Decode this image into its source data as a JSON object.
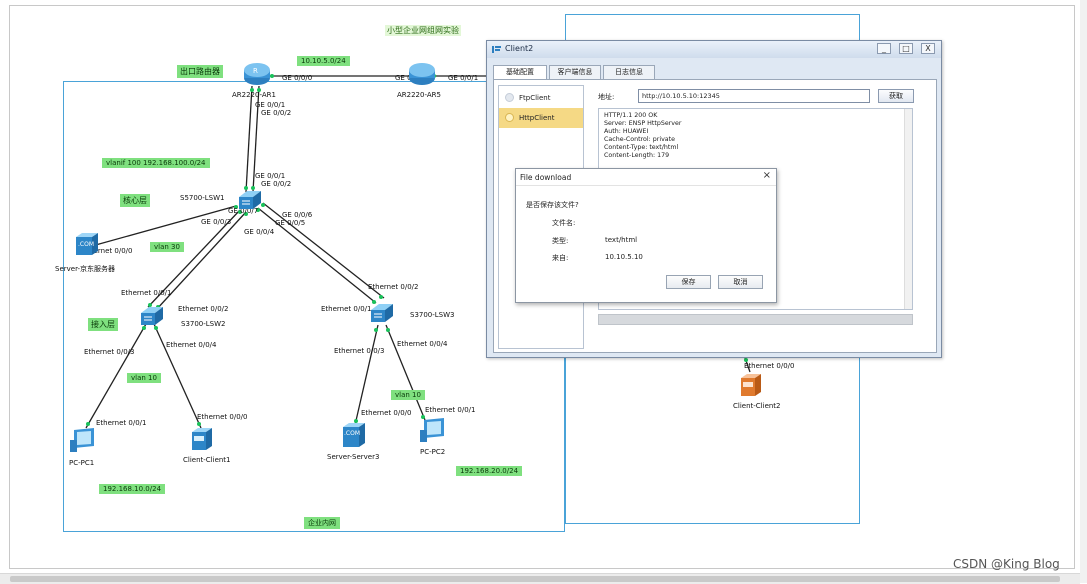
{
  "topology": {
    "title": "小型企业网组网实验",
    "areas": {
      "internal_label": "企业内网",
      "right_label": ""
    },
    "labels": {
      "exit_router": "出口路由器",
      "core_layer": "核心层",
      "access_layer": "接入层",
      "net_wan": "10.10.5.0/24",
      "vlanif": "vlanif 100 192.168.100.0/24",
      "vlan30": "vlan 30",
      "vlan10": "vlan 10",
      "vlan10b": "vlan 10",
      "net10": "192.168.10.0/24",
      "net20": "192.168.20.0/24"
    },
    "devices": {
      "ar1": "AR2220-AR1",
      "ar5": "AR2220-AR5",
      "lsw1": "S5700-LSW1",
      "lsw2": "S3700-LSW2",
      "lsw3": "S3700-LSW3",
      "server_jd": "Server-京东服务器",
      "pc1": "PC-PC1",
      "client1": "Client-Client1",
      "server3": "Server-Server3",
      "pc2": "PC-PC2",
      "client2": "Client-Client2"
    },
    "ports": {
      "ar1_ge000": "GE 0/0/0",
      "ar5_ge000": "GE 0/0/0",
      "ar5_ge001": "GE 0/0/1",
      "ar1_ge001": "GE 0/0/1",
      "ar1_ge002": "GE 0/0/2",
      "lsw1_ge001": "GE 0/0/1",
      "lsw1_ge002": "GE 0/0/2",
      "lsw1_ge007": "GE 0/0/7",
      "lsw1_ge003": "GE 0/0/3",
      "lsw1_ge004": "GE 0/0/4",
      "lsw1_ge006": "GE 0/0/6",
      "lsw1_ge005": "GE 0/0/5",
      "jd_eth": "Ethernet 0/0/0",
      "lsw2_e001": "Ethernet 0/0/1",
      "lsw2_e002": "Ethernet 0/0/2",
      "lsw2_e003": "Ethernet 0/0/3",
      "lsw2_e004": "Ethernet 0/0/4",
      "lsw3_e002": "Ethernet 0/0/2",
      "lsw3_e001": "Ethernet 0/0/1",
      "lsw3_e003": "Ethernet 0/0/3",
      "lsw3_e004": "Ethernet 0/0/4",
      "pc1_eth": "Ethernet 0/0/1",
      "client1_eth": "Ethernet 0/0/0",
      "server3_eth": "Ethernet 0/0/0",
      "pc2_eth": "Ethernet 0/0/1",
      "client2_eth": "Ethernet 0/0/0"
    }
  },
  "client_window": {
    "title": "Client2",
    "controls": {
      "minimize": "_",
      "maximize": "□",
      "close": "X"
    },
    "tabs": [
      "基础配置",
      "客户端信息",
      "日志信息"
    ],
    "sidebar": [
      {
        "label": "FtpClient"
      },
      {
        "label": "HttpClient"
      }
    ],
    "address_label": "地址:",
    "address_value": "http://10.10.5.10:12345",
    "get_button": "获取",
    "response_lines": [
      "HTTP/1.1 200 OK",
      "Server: ENSP HttpServer",
      "Auth: HUAWEI",
      "Cache-Control: private",
      "Content-Type: text/html",
      "Content-Length: 179"
    ]
  },
  "dialog": {
    "title": "File download",
    "close": "×",
    "question": "是否保存该文件?",
    "rows": [
      {
        "key": "文件名:",
        "value": ""
      },
      {
        "key": "类型:",
        "value": "text/html"
      },
      {
        "key": "来自:",
        "value": "10.10.5.10"
      }
    ],
    "save_button": "保存",
    "cancel_button": "取消"
  },
  "watermark": "CSDN @King Blog",
  "colors": {
    "accent_blue": "#4aa3d8",
    "label_green": "#7fe07f",
    "selected_item": "#f5d985"
  }
}
